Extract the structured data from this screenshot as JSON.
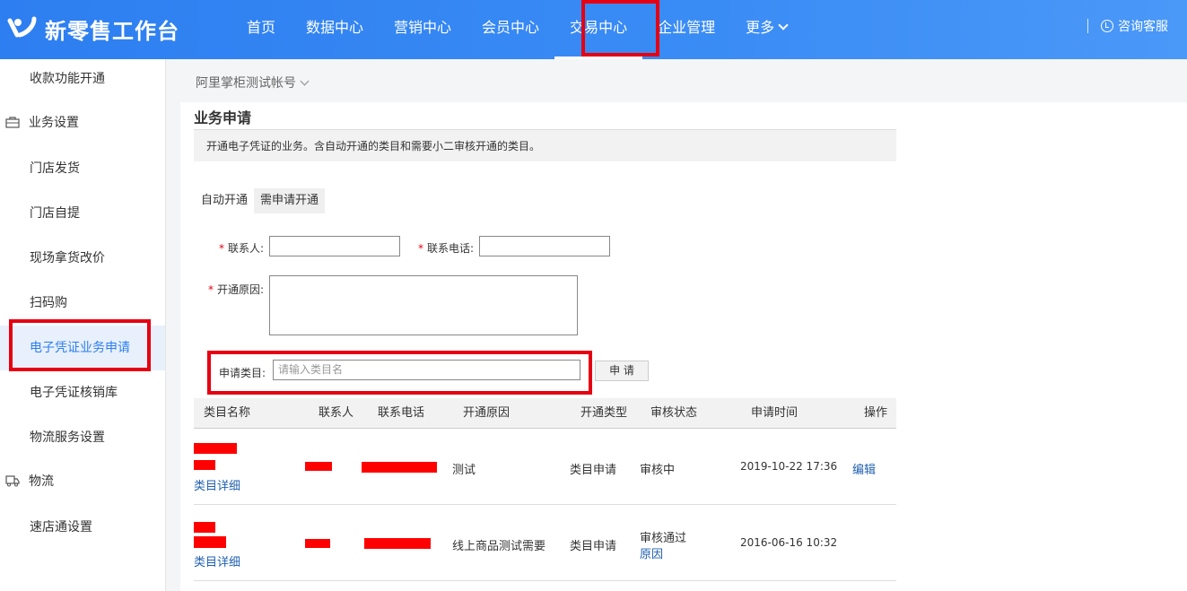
{
  "header": {
    "app_title": "新零售工作台",
    "nav": [
      {
        "label": "首页"
      },
      {
        "label": "数据中心"
      },
      {
        "label": "营销中心"
      },
      {
        "label": "会员中心"
      },
      {
        "label": "交易中心",
        "active": true
      },
      {
        "label": "企业管理"
      },
      {
        "label": "更多"
      }
    ],
    "support_label": "咨询客服"
  },
  "sidebar": {
    "items": [
      {
        "label": "收款功能开通"
      },
      {
        "label": "业务设置",
        "group": true,
        "icon": "briefcase-icon"
      },
      {
        "label": "门店发货"
      },
      {
        "label": "门店自提"
      },
      {
        "label": "现场拿货改价"
      },
      {
        "label": "扫码购"
      },
      {
        "label": "电子凭证业务申请",
        "active": true
      },
      {
        "label": "电子凭证核销库"
      },
      {
        "label": "物流服务设置"
      },
      {
        "label": "物流",
        "group": true,
        "icon": "truck-icon"
      },
      {
        "label": "速店通设置"
      }
    ]
  },
  "main": {
    "account": "阿里掌柜测试帐号",
    "title": "业务申请",
    "notice": "开通电子凭证的业务。含自动开通的类目和需要小二审核开通的类目。",
    "tabs": [
      {
        "label": "自动开通"
      },
      {
        "label": "需申请开通",
        "active": true
      }
    ],
    "form": {
      "contact_label": "联系人:",
      "phone_label": "联系电话:",
      "reason_label": "开通原因:",
      "required_mark": "*",
      "category_label": "申请类目:",
      "category_placeholder": "请输入类目名",
      "apply_button": "申 请"
    },
    "table": {
      "headers": [
        "类目名称",
        "联系人",
        "联系电话",
        "开通原因",
        "开通类型",
        "审核状态",
        "申请时间",
        "操作"
      ],
      "rows": [
        {
          "detail_link": "类目详细",
          "reason": "测试",
          "type": "类目申请",
          "status": "审核中",
          "status_link": "",
          "time": "2019-10-22 17:36",
          "action": "编辑"
        },
        {
          "detail_link": "类目详细",
          "reason": "线上商品测试需要",
          "type": "类目申请",
          "status": "审核通过",
          "status_link": "原因",
          "time": "2016-06-16 10:32",
          "action": ""
        }
      ]
    }
  },
  "colors": {
    "header_blue": "#2d7ef0",
    "highlight_red": "#e60012",
    "link_blue": "#2060b0"
  }
}
